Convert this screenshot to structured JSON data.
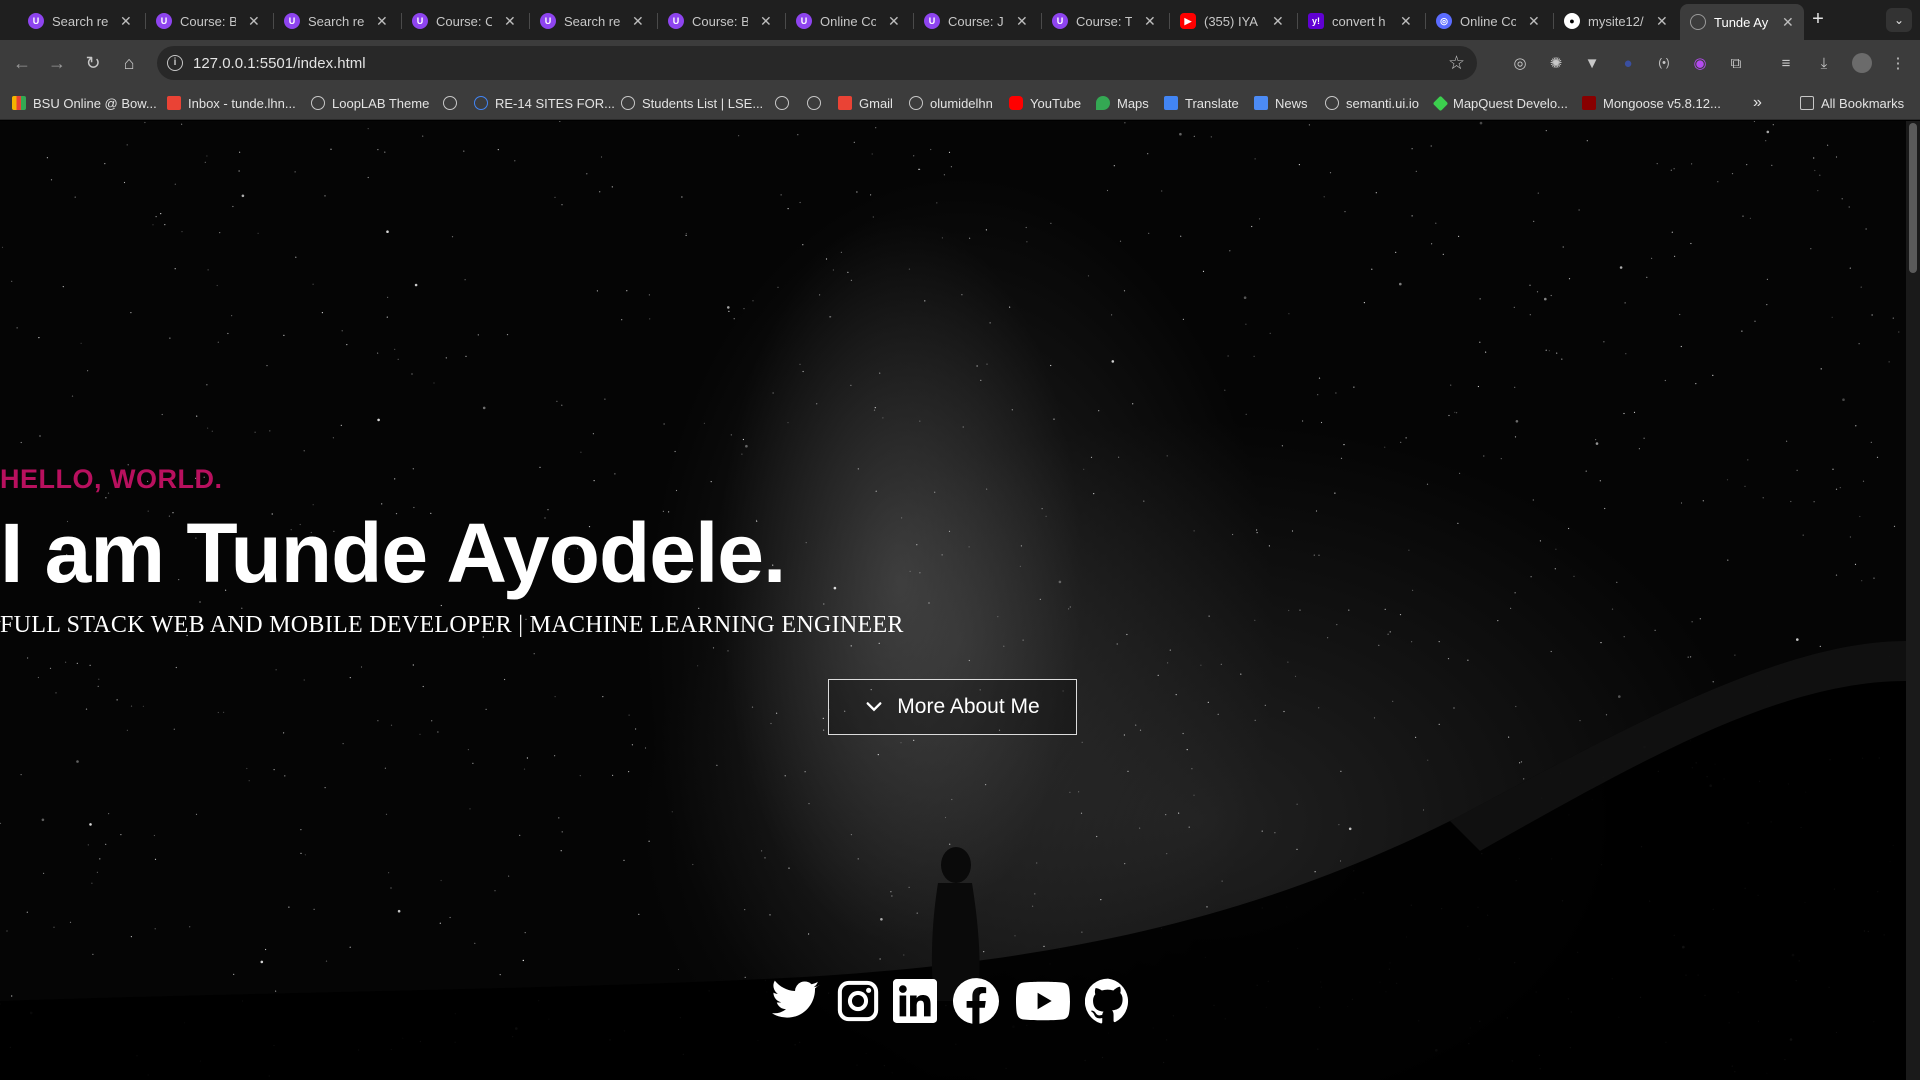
{
  "browser": {
    "tabs": [
      {
        "title": "Search re",
        "icon": "u-icon",
        "color": "#8e44ef"
      },
      {
        "title": "Course: B",
        "icon": "u-icon",
        "color": "#8e44ef"
      },
      {
        "title": "Search re",
        "icon": "u-icon",
        "color": "#8e44ef"
      },
      {
        "title": "Course: C",
        "icon": "u-icon",
        "color": "#8e44ef"
      },
      {
        "title": "Search re",
        "icon": "u-icon",
        "color": "#8e44ef"
      },
      {
        "title": "Course: B",
        "icon": "u-icon",
        "color": "#8e44ef"
      },
      {
        "title": "Online Co",
        "icon": "u-icon",
        "color": "#8e44ef"
      },
      {
        "title": "Course: J",
        "icon": "u-icon",
        "color": "#8e44ef"
      },
      {
        "title": "Course: T",
        "icon": "u-icon",
        "color": "#8e44ef"
      },
      {
        "title": "(355) IYA",
        "icon": "youtube-icon",
        "color": "#ff0000"
      },
      {
        "title": "convert h",
        "icon": "yahoo-icon",
        "color": "#6001d2"
      },
      {
        "title": "Online Co",
        "icon": "globe-icon",
        "color": "#5b6cff"
      },
      {
        "title": "mysite12/",
        "icon": "github-icon",
        "color": "#ffffff"
      },
      {
        "title": "Tunde Ay",
        "icon": "globe-icon",
        "color": "#9a9a9a"
      }
    ],
    "new_tab": "+",
    "url": "127.0.0.1:5501/index.html",
    "bookmarks": [
      {
        "label": "BSU Online @ Bow...",
        "icon": "bars-icon"
      },
      {
        "label": "Inbox - tunde.lhn...",
        "icon": "gmail-icon"
      },
      {
        "label": "LoopLAB Theme",
        "icon": "globe-icon"
      },
      {
        "label": "",
        "icon": "globe-icon"
      },
      {
        "label": "RE-14 SITES FOR...",
        "icon": "google-icon"
      },
      {
        "label": "Students List | LSE...",
        "icon": "globe-icon"
      },
      {
        "label": "",
        "icon": "globe-icon"
      },
      {
        "label": "",
        "icon": "globe-icon"
      },
      {
        "label": "Gmail",
        "icon": "gmail-icon"
      },
      {
        "label": "olumidelhn",
        "icon": "globe-icon"
      },
      {
        "label": "YouTube",
        "icon": "youtube-icon"
      },
      {
        "label": "Maps",
        "icon": "maps-icon"
      },
      {
        "label": "Translate",
        "icon": "translate-icon"
      },
      {
        "label": "News",
        "icon": "news-icon"
      },
      {
        "label": "semanti.ui.io",
        "icon": "globe-icon"
      },
      {
        "label": "MapQuest Develo...",
        "icon": "mapquest-icon"
      },
      {
        "label": "Mongoose v5.8.12...",
        "icon": "mongoose-icon"
      }
    ],
    "more_bookmarks": "»",
    "all_bookmarks": "All Bookmarks"
  },
  "hero": {
    "greeting": "HELLO, WORLD.",
    "headline": "I am Tunde Ayodele.",
    "subtitle": "FULL STACK WEB AND MOBILE DEVELOPER | MACHINE LEARNING ENGINEER",
    "cta_label": "More About Me",
    "accent_color": "#b8105e"
  },
  "social_links": [
    {
      "name": "twitter"
    },
    {
      "name": "instagram"
    },
    {
      "name": "linkedin"
    },
    {
      "name": "facebook"
    },
    {
      "name": "youtube"
    },
    {
      "name": "github"
    }
  ]
}
